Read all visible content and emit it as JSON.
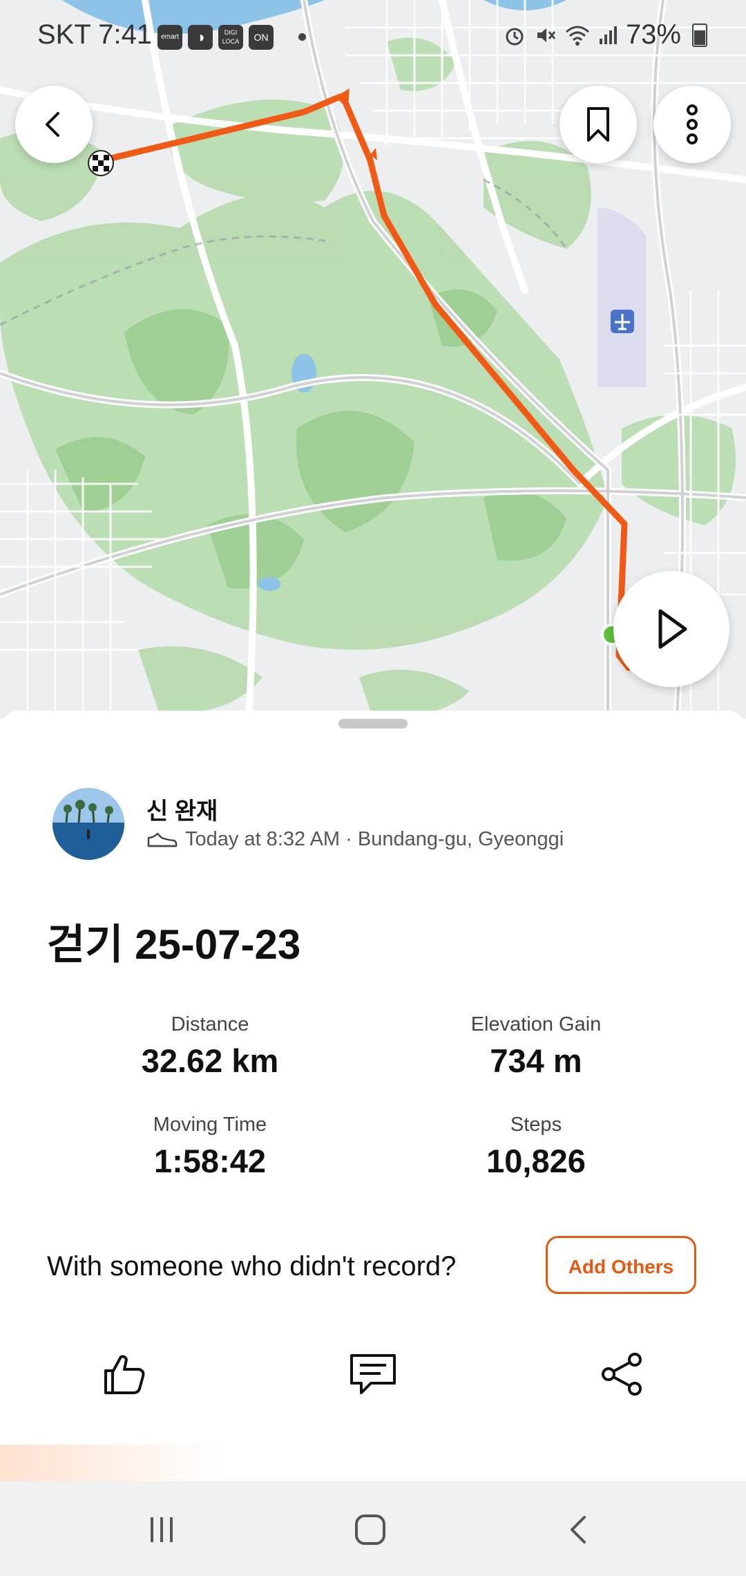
{
  "status_bar": {
    "carrier": "SKT",
    "time": "7:41",
    "app_icons": [
      "emart",
      "moon-icon",
      "DIGI LOCA",
      "ON"
    ],
    "battery": "73%"
  },
  "map": {
    "route_color": "#f05a15",
    "icons": [
      "back-icon",
      "bookmark-icon",
      "more-icon",
      "play-icon",
      "airport-icon",
      "finish-flag-icon"
    ]
  },
  "activity": {
    "athlete_name": "신 완재",
    "meta": "Today at 8:32 AM · Bundang-gu, Gyeonggi",
    "sport_icon": "shoe-icon",
    "title": "걷기 25-07-23"
  },
  "stats": [
    {
      "label": "Distance",
      "value": "32.62 km"
    },
    {
      "label": "Elevation Gain",
      "value": "734 m"
    },
    {
      "label": "Moving Time",
      "value": "1:58:42"
    },
    {
      "label": "Steps",
      "value": "10,826"
    }
  ],
  "prompt": {
    "question": "With someone who didn't record?",
    "button_label": "Add Others"
  },
  "actions": [
    "thumbs-up-icon",
    "comment-icon",
    "share-icon"
  ],
  "accent_color": "#e8580f"
}
